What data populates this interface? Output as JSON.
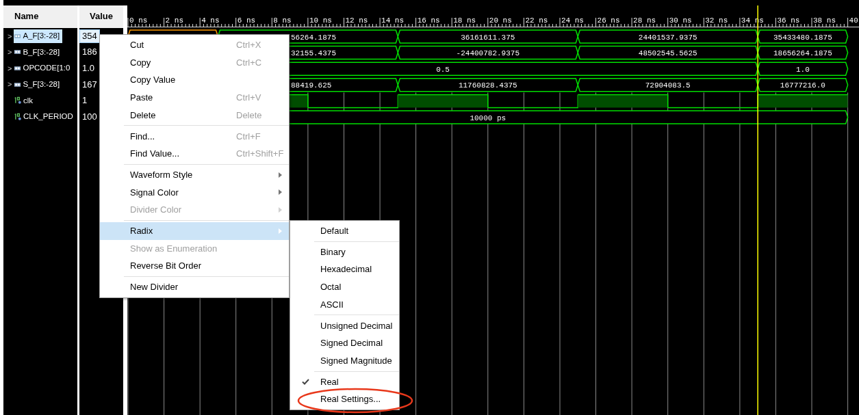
{
  "columns": [
    {
      "label": "Name"
    },
    {
      "label": "Value"
    }
  ],
  "signals": [
    {
      "expander": ">",
      "name": "A_F[3:-28]",
      "value": "354",
      "kind": "bus",
      "expanded": false,
      "selected": true
    },
    {
      "expander": ">",
      "name": "B_F[3:-28]",
      "value": "186",
      "kind": "bus",
      "expanded": false,
      "selected": false
    },
    {
      "expander": ">",
      "name": "OPCODE[1:0",
      "value": "1.0",
      "kind": "bus",
      "expanded": false,
      "selected": false
    },
    {
      "expander": ">",
      "name": "S_F[3:-28]",
      "value": "167",
      "kind": "bus",
      "expanded": false,
      "selected": false
    },
    {
      "name": "clk",
      "value": "1",
      "kind": "bit",
      "selected": false
    },
    {
      "name": "CLK_PERIOD",
      "value": "100",
      "kind": "bit",
      "selected": false
    }
  ],
  "waveform": {
    "ruler": [
      "0 ns",
      "2 ns",
      "4 ns",
      "6 ns",
      "8 ns",
      "10 ns",
      "12 ns",
      "14 ns",
      "16 ns",
      "18 ns",
      "20 ns",
      "22 ns",
      "24 ns",
      "26 ns",
      "28 ns",
      "30 ns",
      "32 ns",
      "34 ns",
      "36 ns",
      "38 ns",
      "40"
    ],
    "traces": [
      {
        "kind": "bus",
        "segments": [
          {
            "selected": true
          },
          {
            "label": "56264.1875",
            "clipped_left": true,
            "selected": false
          },
          {
            "label": "36161611.375",
            "selected": false
          },
          {
            "label": "24401537.9375",
            "selected": false
          },
          {
            "label": "35433480.1875",
            "selected": false
          }
        ]
      },
      {
        "kind": "bus",
        "segments": [
          {
            "label": "32155.4375",
            "clipped_left": true
          },
          {
            "label": "-24400782.9375"
          },
          {
            "label": "48502545.5625"
          },
          {
            "label": "18656264.1875"
          }
        ]
      },
      {
        "kind": "bus",
        "segments": [
          {
            "label": "0.5"
          },
          {
            "label": "1.0"
          }
        ]
      },
      {
        "kind": "bus",
        "segments": [
          {
            "label": "88419.625",
            "clipped_left": true
          },
          {
            "label": "11760828.4375"
          },
          {
            "label": "72904083.5"
          },
          {
            "label": "16777216.0"
          }
        ]
      },
      {
        "kind": "bit",
        "segments": [
          {
            "high": true
          },
          {
            "high": false
          },
          {
            "high": true
          },
          {
            "high": false
          },
          {
            "high": true
          },
          {
            "high": false
          },
          {
            "high": true
          }
        ]
      },
      {
        "kind": "bus",
        "segments": [
          {
            "label": "10000 ps"
          }
        ]
      }
    ]
  },
  "context_menu": {
    "items": [
      {
        "kind": "item",
        "label": "Cut",
        "shortcut": "Ctrl+X"
      },
      {
        "kind": "item",
        "label": "Copy",
        "shortcut": "Ctrl+C"
      },
      {
        "kind": "item",
        "label": "Copy Value"
      },
      {
        "kind": "item",
        "label": "Paste",
        "shortcut": "Ctrl+V"
      },
      {
        "kind": "item",
        "label": "Delete",
        "shortcut": "Delete"
      },
      {
        "kind": "separator"
      },
      {
        "kind": "item",
        "label": "Find...",
        "shortcut": "Ctrl+F"
      },
      {
        "kind": "item",
        "label": "Find Value...",
        "shortcut": "Ctrl+Shift+F"
      },
      {
        "kind": "separator"
      },
      {
        "kind": "submenu",
        "label": "Waveform Style"
      },
      {
        "kind": "submenu",
        "label": "Signal Color"
      },
      {
        "kind": "submenu",
        "label": "Divider Color",
        "disabled": true
      },
      {
        "kind": "separator"
      },
      {
        "kind": "submenu",
        "label": "Radix",
        "highlighted": true
      },
      {
        "kind": "item",
        "label": "Show as Enumeration",
        "disabled": true
      },
      {
        "kind": "item",
        "label": "Reverse Bit Order"
      },
      {
        "kind": "separator"
      },
      {
        "kind": "item",
        "label": "New Divider"
      }
    ]
  },
  "radix_submenu": {
    "items": [
      {
        "kind": "item",
        "label": "Default",
        "checked": false
      },
      {
        "kind": "separator"
      },
      {
        "kind": "item",
        "label": "Binary",
        "checked": false
      },
      {
        "kind": "item",
        "label": "Hexadecimal",
        "checked": false
      },
      {
        "kind": "item",
        "label": "Octal",
        "checked": false
      },
      {
        "kind": "item",
        "label": "ASCII",
        "checked": false
      },
      {
        "kind": "separator"
      },
      {
        "kind": "item",
        "label": "Unsigned Decimal",
        "checked": false
      },
      {
        "kind": "item",
        "label": "Signed Decimal",
        "checked": false
      },
      {
        "kind": "item",
        "label": "Signed Magnitude",
        "checked": false
      },
      {
        "kind": "separator"
      },
      {
        "kind": "item",
        "label": "Real",
        "checked": true
      },
      {
        "kind": "item",
        "label": "Real Settings...",
        "checked": false,
        "circled": true
      }
    ]
  }
}
